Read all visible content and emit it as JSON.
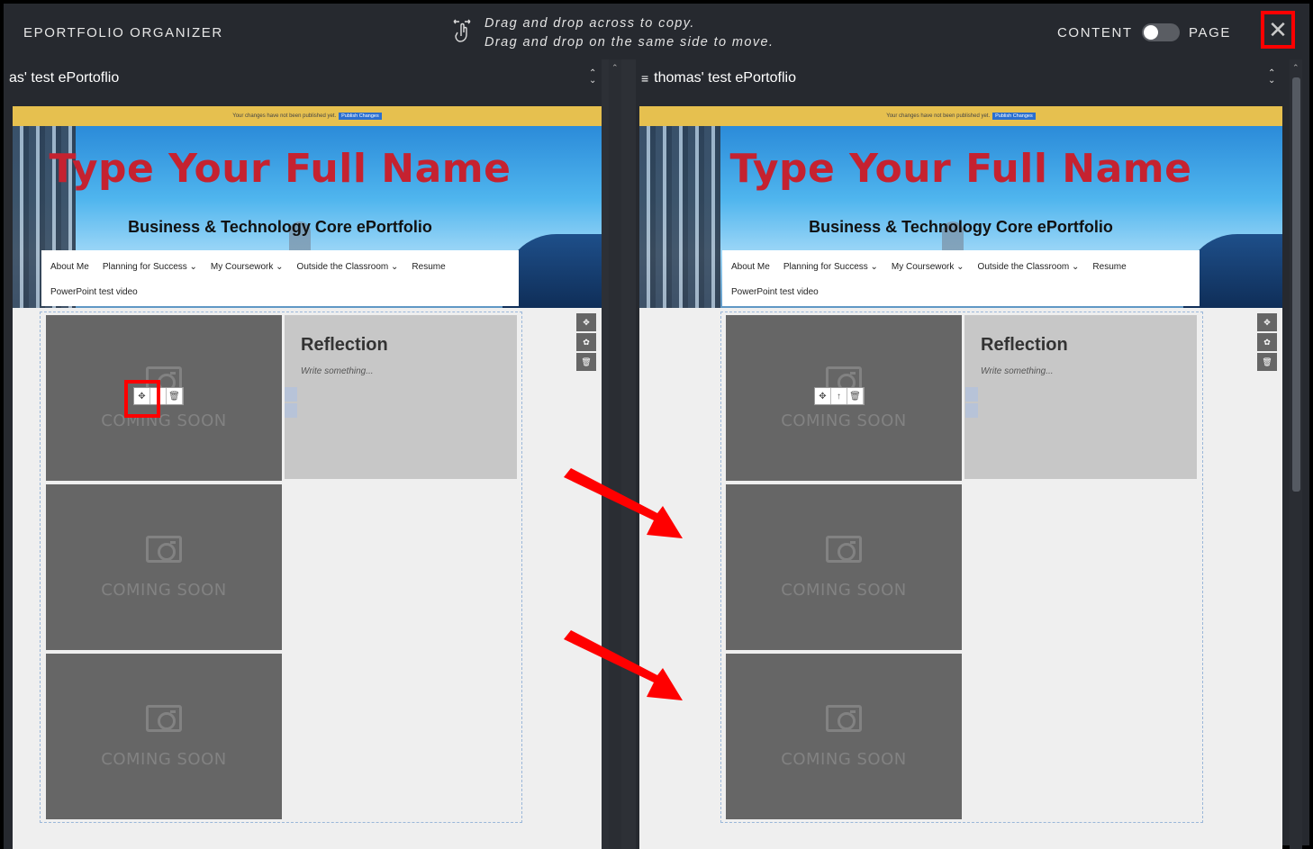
{
  "topbar": {
    "title": "EPORTFOLIO ORGANIZER",
    "hint_line1": "Drag and drop across to copy.",
    "hint_line2": "Drag and drop on the same side to move.",
    "mode_left": "CONTENT",
    "mode_right": "PAGE",
    "toggle_state": "content",
    "close_label": "✕"
  },
  "left_pane": {
    "header": "as' test ePortoflio"
  },
  "right_pane": {
    "header": "thomas' test ePortoflio",
    "header_icon": "list-icon"
  },
  "preview": {
    "notice_text": "Your changes have not been published yet.",
    "notice_button": "Publish Changes",
    "site_name": "Type Your Full Name",
    "site_subtitle": "Business & Technology Core ePortfolio",
    "nav_items": [
      "About Me",
      "Planning for Success ⌄",
      "My Coursework ⌄",
      "Outside the Classroom ⌄",
      "Resume"
    ],
    "nav_items_row2": [
      "PowerPoint test video"
    ],
    "photo_placeholder": "COMING SOON",
    "reflection_title": "Reflection",
    "reflection_body": "Write something..."
  },
  "colors": {
    "chrome_bg": "#26292f",
    "site_name": "#c52230",
    "notice_bar": "#e6c04f",
    "highlight": "#ff0000"
  }
}
